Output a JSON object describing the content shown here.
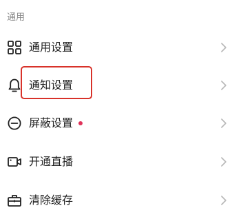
{
  "section": {
    "header": "通用"
  },
  "items": [
    {
      "label": "通用设置",
      "icon": "grid-icon"
    },
    {
      "label": "通知设置",
      "icon": "bell-icon"
    },
    {
      "label": "屏蔽设置",
      "icon": "block-icon",
      "badge_color": "#e0335a"
    },
    {
      "label": "开通直播",
      "icon": "video-camera-icon"
    },
    {
      "label": "清除缓存",
      "icon": "briefcase-icon"
    }
  ],
  "colors": {
    "text": "#1f1f1f",
    "header_text": "#8a8a8a",
    "chevron": "#b7b7b7",
    "highlight": "#d8322a",
    "badge": "#e0335a"
  }
}
